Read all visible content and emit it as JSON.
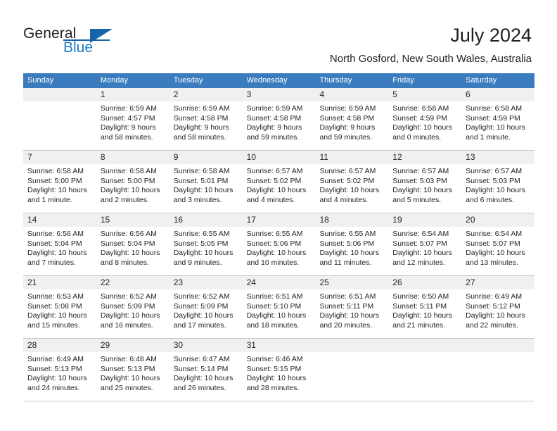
{
  "brand": {
    "word_one": "General",
    "word_two": "Blue",
    "accent_color": "#1764a8"
  },
  "header": {
    "title": "July 2024",
    "location": "North Gosford, New South Wales, Australia"
  },
  "calendar": {
    "header_bg": "#3a7cbe",
    "daynum_bg": "#f0f0f0",
    "weekday_headers": [
      "Sunday",
      "Monday",
      "Tuesday",
      "Wednesday",
      "Thursday",
      "Friday",
      "Saturday"
    ],
    "weeks": [
      [
        {
          "day": "",
          "lines": []
        },
        {
          "day": "1",
          "lines": [
            "Sunrise: 6:59 AM",
            "Sunset: 4:57 PM",
            "Daylight: 9 hours",
            "and 58 minutes."
          ]
        },
        {
          "day": "2",
          "lines": [
            "Sunrise: 6:59 AM",
            "Sunset: 4:58 PM",
            "Daylight: 9 hours",
            "and 58 minutes."
          ]
        },
        {
          "day": "3",
          "lines": [
            "Sunrise: 6:59 AM",
            "Sunset: 4:58 PM",
            "Daylight: 9 hours",
            "and 59 minutes."
          ]
        },
        {
          "day": "4",
          "lines": [
            "Sunrise: 6:59 AM",
            "Sunset: 4:58 PM",
            "Daylight: 9 hours",
            "and 59 minutes."
          ]
        },
        {
          "day": "5",
          "lines": [
            "Sunrise: 6:58 AM",
            "Sunset: 4:59 PM",
            "Daylight: 10 hours",
            "and 0 minutes."
          ]
        },
        {
          "day": "6",
          "lines": [
            "Sunrise: 6:58 AM",
            "Sunset: 4:59 PM",
            "Daylight: 10 hours",
            "and 1 minute."
          ]
        }
      ],
      [
        {
          "day": "7",
          "lines": [
            "Sunrise: 6:58 AM",
            "Sunset: 5:00 PM",
            "Daylight: 10 hours",
            "and 1 minute."
          ]
        },
        {
          "day": "8",
          "lines": [
            "Sunrise: 6:58 AM",
            "Sunset: 5:00 PM",
            "Daylight: 10 hours",
            "and 2 minutes."
          ]
        },
        {
          "day": "9",
          "lines": [
            "Sunrise: 6:58 AM",
            "Sunset: 5:01 PM",
            "Daylight: 10 hours",
            "and 3 minutes."
          ]
        },
        {
          "day": "10",
          "lines": [
            "Sunrise: 6:57 AM",
            "Sunset: 5:02 PM",
            "Daylight: 10 hours",
            "and 4 minutes."
          ]
        },
        {
          "day": "11",
          "lines": [
            "Sunrise: 6:57 AM",
            "Sunset: 5:02 PM",
            "Daylight: 10 hours",
            "and 4 minutes."
          ]
        },
        {
          "day": "12",
          "lines": [
            "Sunrise: 6:57 AM",
            "Sunset: 5:03 PM",
            "Daylight: 10 hours",
            "and 5 minutes."
          ]
        },
        {
          "day": "13",
          "lines": [
            "Sunrise: 6:57 AM",
            "Sunset: 5:03 PM",
            "Daylight: 10 hours",
            "and 6 minutes."
          ]
        }
      ],
      [
        {
          "day": "14",
          "lines": [
            "Sunrise: 6:56 AM",
            "Sunset: 5:04 PM",
            "Daylight: 10 hours",
            "and 7 minutes."
          ]
        },
        {
          "day": "15",
          "lines": [
            "Sunrise: 6:56 AM",
            "Sunset: 5:04 PM",
            "Daylight: 10 hours",
            "and 8 minutes."
          ]
        },
        {
          "day": "16",
          "lines": [
            "Sunrise: 6:55 AM",
            "Sunset: 5:05 PM",
            "Daylight: 10 hours",
            "and 9 minutes."
          ]
        },
        {
          "day": "17",
          "lines": [
            "Sunrise: 6:55 AM",
            "Sunset: 5:06 PM",
            "Daylight: 10 hours",
            "and 10 minutes."
          ]
        },
        {
          "day": "18",
          "lines": [
            "Sunrise: 6:55 AM",
            "Sunset: 5:06 PM",
            "Daylight: 10 hours",
            "and 11 minutes."
          ]
        },
        {
          "day": "19",
          "lines": [
            "Sunrise: 6:54 AM",
            "Sunset: 5:07 PM",
            "Daylight: 10 hours",
            "and 12 minutes."
          ]
        },
        {
          "day": "20",
          "lines": [
            "Sunrise: 6:54 AM",
            "Sunset: 5:07 PM",
            "Daylight: 10 hours",
            "and 13 minutes."
          ]
        }
      ],
      [
        {
          "day": "21",
          "lines": [
            "Sunrise: 6:53 AM",
            "Sunset: 5:08 PM",
            "Daylight: 10 hours",
            "and 15 minutes."
          ]
        },
        {
          "day": "22",
          "lines": [
            "Sunrise: 6:52 AM",
            "Sunset: 5:09 PM",
            "Daylight: 10 hours",
            "and 16 minutes."
          ]
        },
        {
          "day": "23",
          "lines": [
            "Sunrise: 6:52 AM",
            "Sunset: 5:09 PM",
            "Daylight: 10 hours",
            "and 17 minutes."
          ]
        },
        {
          "day": "24",
          "lines": [
            "Sunrise: 6:51 AM",
            "Sunset: 5:10 PM",
            "Daylight: 10 hours",
            "and 18 minutes."
          ]
        },
        {
          "day": "25",
          "lines": [
            "Sunrise: 6:51 AM",
            "Sunset: 5:11 PM",
            "Daylight: 10 hours",
            "and 20 minutes."
          ]
        },
        {
          "day": "26",
          "lines": [
            "Sunrise: 6:50 AM",
            "Sunset: 5:11 PM",
            "Daylight: 10 hours",
            "and 21 minutes."
          ]
        },
        {
          "day": "27",
          "lines": [
            "Sunrise: 6:49 AM",
            "Sunset: 5:12 PM",
            "Daylight: 10 hours",
            "and 22 minutes."
          ]
        }
      ],
      [
        {
          "day": "28",
          "lines": [
            "Sunrise: 6:49 AM",
            "Sunset: 5:13 PM",
            "Daylight: 10 hours",
            "and 24 minutes."
          ]
        },
        {
          "day": "29",
          "lines": [
            "Sunrise: 6:48 AM",
            "Sunset: 5:13 PM",
            "Daylight: 10 hours",
            "and 25 minutes."
          ]
        },
        {
          "day": "30",
          "lines": [
            "Sunrise: 6:47 AM",
            "Sunset: 5:14 PM",
            "Daylight: 10 hours",
            "and 26 minutes."
          ]
        },
        {
          "day": "31",
          "lines": [
            "Sunrise: 6:46 AM",
            "Sunset: 5:15 PM",
            "Daylight: 10 hours",
            "and 28 minutes."
          ]
        },
        {
          "day": "",
          "lines": []
        },
        {
          "day": "",
          "lines": []
        },
        {
          "day": "",
          "lines": []
        }
      ]
    ]
  }
}
